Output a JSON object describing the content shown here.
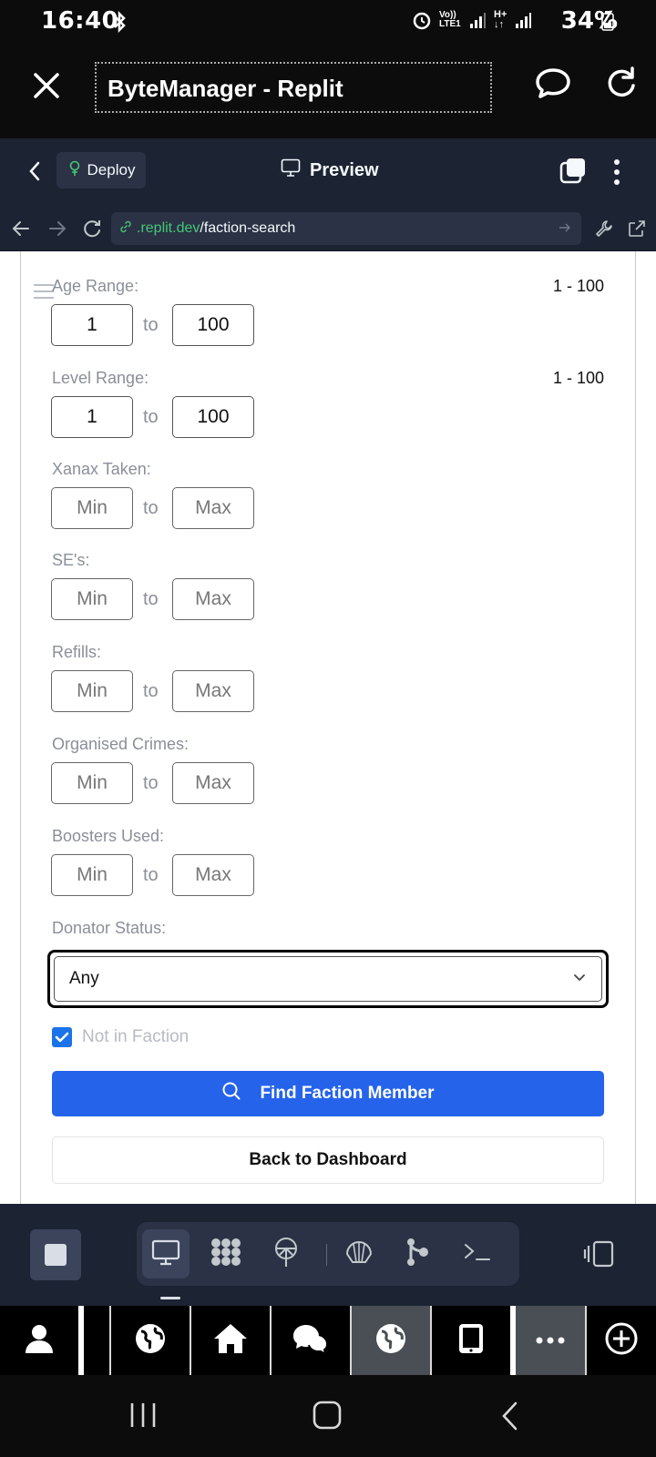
{
  "status": {
    "time": "16:40",
    "battery": "34%",
    "net_label": "Vo))\nLTE1"
  },
  "browser": {
    "title": "ByteManager - Replit"
  },
  "replit": {
    "deploy_label": "Deploy",
    "preview_label": "Preview",
    "url_host": ".replit.dev",
    "url_path": "/faction-search"
  },
  "form": {
    "to_label": "to",
    "age": {
      "label": "Age Range:",
      "range_text": "1 - 100",
      "min": "1",
      "max": "100"
    },
    "level": {
      "label": "Level Range:",
      "range_text": "1 - 100",
      "min": "1",
      "max": "100"
    },
    "xanax": {
      "label": "Xanax Taken:",
      "min_placeholder": "Min",
      "max_placeholder": "Max"
    },
    "se": {
      "label": "SE's:",
      "min_placeholder": "Min",
      "max_placeholder": "Max"
    },
    "refills": {
      "label": "Refills:",
      "min_placeholder": "Min",
      "max_placeholder": "Max"
    },
    "oc": {
      "label": "Organised Crimes:",
      "min_placeholder": "Min",
      "max_placeholder": "Max"
    },
    "boosters": {
      "label": "Boosters Used:",
      "min_placeholder": "Min",
      "max_placeholder": "Max"
    },
    "donator": {
      "label": "Donator Status:",
      "selected": "Any"
    },
    "not_in_faction": {
      "label": "Not in Faction",
      "checked": true
    },
    "find_button": "Find Faction Member",
    "back_button": "Back to Dashboard"
  },
  "colors": {
    "accent": "#2563eb",
    "replit_bg": "#1c2333",
    "url_host": "#44c776"
  }
}
